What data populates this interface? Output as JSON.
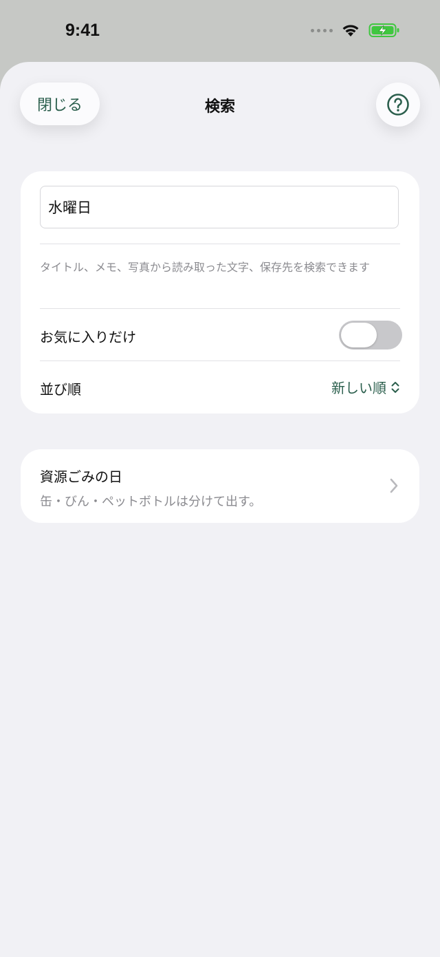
{
  "status_bar": {
    "time": "9:41"
  },
  "header": {
    "close_label": "閉じる",
    "title": "検索",
    "help_icon": "question-circle-icon"
  },
  "search": {
    "query": "水曜日",
    "hint": "タイトル、メモ、写真から読み取った文字、保存先を検索できます",
    "favorites_label": "お気に入りだけ",
    "favorites_on": false,
    "sort_label": "並び順",
    "sort_value": "新しい順"
  },
  "results": [
    {
      "title": "資源ごみの日",
      "subtitle": "缶・びん・ペットボトルは分けて出す。"
    }
  ],
  "colors": {
    "accent": "#2a5e4c",
    "battery": "#3fc73f",
    "sheet_background": "#f1f1f5",
    "toggle_off": "#c8c8cb"
  }
}
